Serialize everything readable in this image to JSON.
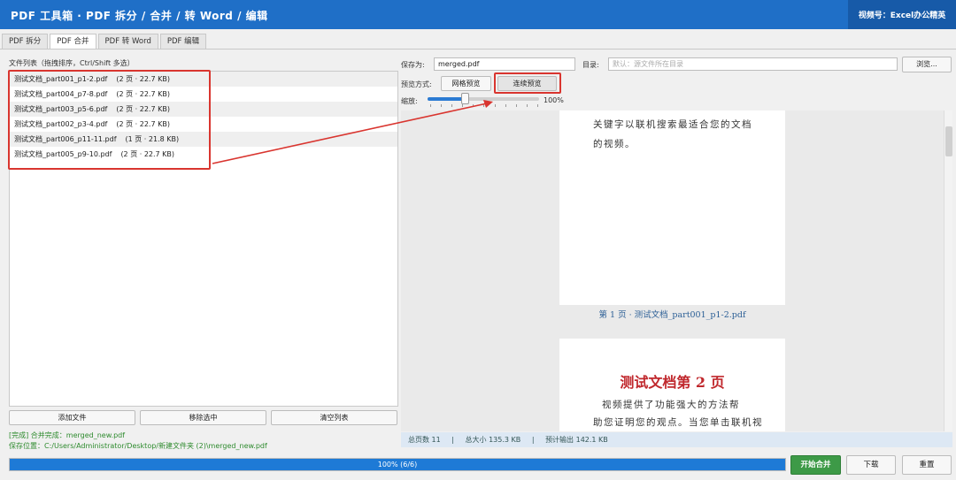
{
  "app": {
    "title": "PDF 工具箱 · PDF 拆分 / 合并 / 转 Word / 编辑",
    "badge": "视频号：Excel办公精英"
  },
  "tabs": [
    "PDF 拆分",
    "PDF 合并",
    "PDF 转 Word",
    "PDF 编辑"
  ],
  "active_tab": "PDF 合并",
  "file_list": {
    "label": "文件列表（拖拽排序，Ctrl/Shift 多选）",
    "files": [
      {
        "name": "测试文档_part001_p1-2.pdf",
        "meta": "(2 页 · 22.7 KB)"
      },
      {
        "name": "测试文档_part004_p7-8.pdf",
        "meta": "(2 页 · 22.7 KB)"
      },
      {
        "name": "测试文档_part003_p5-6.pdf",
        "meta": "(2 页 · 22.7 KB)"
      },
      {
        "name": "测试文档_part002_p3-4.pdf",
        "meta": "(2 页 · 22.7 KB)"
      },
      {
        "name": "测试文档_part006_p11-11.pdf",
        "meta": "(1 页 · 21.8 KB)"
      },
      {
        "name": "测试文档_part005_p9-10.pdf",
        "meta": "(2 页 · 22.7 KB)"
      }
    ]
  },
  "buttons": {
    "add": "添加文件",
    "remove": "移除选中",
    "clear": "清空列表",
    "browse": "浏览...",
    "start": "开始合并",
    "download": "下载",
    "reset": "重置"
  },
  "status": {
    "done": "[完成] 合并完成：merged_new.pdf",
    "path": "保存位置：C:/Users/Administrator/Desktop/新建文件夹 (2)\\merged_new.pdf"
  },
  "save": {
    "label": "保存为:",
    "value": "merged.pdf",
    "dir_label": "目录:",
    "dir_placeholder": "默认：源文件所在目录"
  },
  "preview_mode": {
    "label": "预览方式:",
    "grid": "网格预览",
    "continuous": "连续预览"
  },
  "zoom": {
    "label": "缩放:",
    "value": "100%",
    "level_fraction": 0.33
  },
  "preview": {
    "page1_line1": "关键字以联机搜索最适合您的文档",
    "page1_line2": "的视频。",
    "caption1": "第 1 页 · 测试文档_part001_p1-2.pdf",
    "page2_heading": "测试文档第 2 页",
    "page2_line1": "视频提供了功能强大的方法帮",
    "page2_line2": "助您证明您的观点。当您单击联机视"
  },
  "stats": {
    "total_pages": "总页数 11",
    "total_size": "总大小 135.3 KB",
    "est_output": "预计输出 142.1 KB",
    "sep": "|"
  },
  "progress": {
    "text": "100%  (6/6)",
    "fraction": 1.0
  },
  "colors": {
    "title_bar": "#1f6fc7",
    "highlight": "#d9352f",
    "progress": "#1e7ad6",
    "start_button": "#3d9a47",
    "status_text": "#2e8b2e"
  }
}
